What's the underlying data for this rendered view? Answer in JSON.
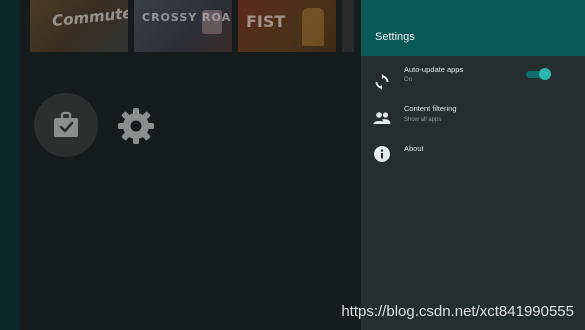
{
  "background_apps": {
    "banners": [
      {
        "name": "commute",
        "text": "Commute"
      },
      {
        "name": "crossy-road",
        "text": "CROSSY ROAD"
      },
      {
        "name": "fist",
        "text": "FIST"
      }
    ],
    "icons": [
      "store-bag-icon",
      "gear-icon"
    ]
  },
  "settings": {
    "title": "Settings",
    "items": [
      {
        "icon": "sync-icon",
        "title": "Auto-update apps",
        "subtitle": "On",
        "toggle_on": true
      },
      {
        "icon": "people-icon",
        "title": "Content filtering",
        "subtitle": "Show all apps"
      },
      {
        "icon": "info-icon",
        "title": "About"
      }
    ]
  },
  "colors": {
    "header": "#0a5a58",
    "panel": "#262d2e",
    "accent": "#2cb5ae"
  },
  "watermark": "https://blog.csdn.net/xct841990555"
}
